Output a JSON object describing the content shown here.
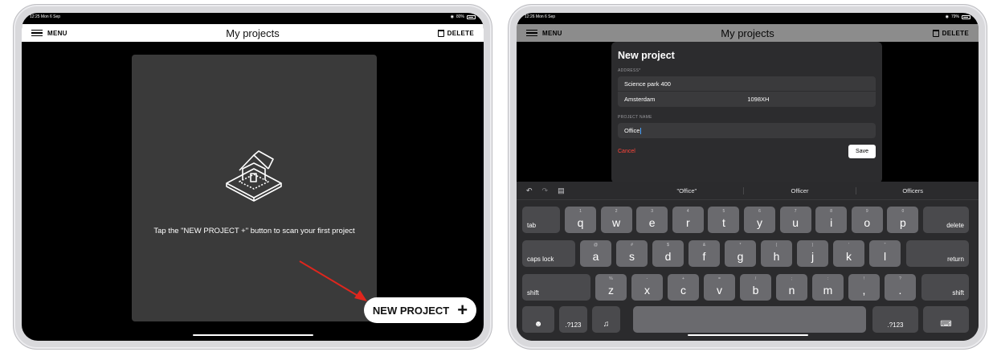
{
  "left": {
    "status": {
      "time": "12:25  Mon 6 Sep",
      "right": "80%"
    },
    "nav": {
      "menu": "MENU",
      "title": "My projects",
      "delete": "DELETE"
    },
    "hint": "Tap the \"NEW PROJECT +\" button to scan your first project",
    "new_project": {
      "label": "NEW PROJECT",
      "icon": "+"
    }
  },
  "right": {
    "status": {
      "time": "12:26  Mon 6 Sep",
      "right": "79%"
    },
    "nav": {
      "menu": "MENU",
      "title": "My projects",
      "delete": "DELETE"
    },
    "modal": {
      "title": "New project",
      "address_label": "ADDRESS*",
      "street": "Science park 400",
      "city": "Amsterdam",
      "zip": "1098XH",
      "name_label": "PROJECT NAME",
      "name_value": "Office",
      "cancel": "Cancel",
      "save": "Save"
    },
    "keyboard": {
      "suggestions": [
        "\"Office\"",
        "Officer",
        "Officers"
      ],
      "row1": [
        [
          "1",
          "q"
        ],
        [
          "2",
          "w"
        ],
        [
          "3",
          "e"
        ],
        [
          "4",
          "r"
        ],
        [
          "5",
          "t"
        ],
        [
          "6",
          "y"
        ],
        [
          "7",
          "u"
        ],
        [
          "8",
          "i"
        ],
        [
          "9",
          "o"
        ],
        [
          "0",
          "p"
        ]
      ],
      "row2": [
        [
          "@",
          "a"
        ],
        [
          "#",
          "s"
        ],
        [
          "$",
          "d"
        ],
        [
          "&",
          "f"
        ],
        [
          "*",
          "g"
        ],
        [
          "(",
          "h"
        ],
        [
          ")",
          "j"
        ],
        [
          "'",
          "k"
        ],
        [
          "\"",
          "l"
        ]
      ],
      "row3": [
        [
          "%",
          "z"
        ],
        [
          "-",
          "x"
        ],
        [
          "+",
          "c"
        ],
        [
          "=",
          "v"
        ],
        [
          "/",
          "b"
        ],
        [
          ";",
          "n"
        ],
        [
          ":",
          "m"
        ],
        [
          "!",
          ","
        ],
        [
          "?",
          "."
        ]
      ],
      "tab": "tab",
      "delete": "delete",
      "caps": "caps lock",
      "return": "return",
      "shift": "shift",
      "numbers": ".?123"
    }
  },
  "colors": {
    "accent_red": "#ff453a",
    "arrow": "#e0261d"
  }
}
